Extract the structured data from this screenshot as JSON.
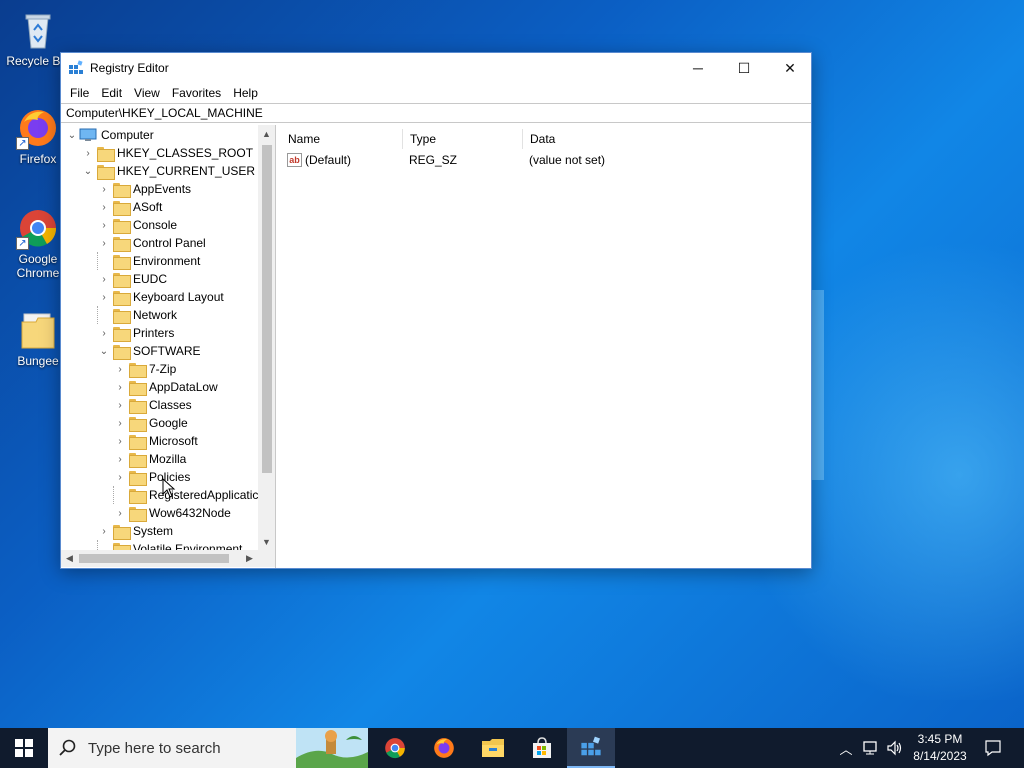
{
  "desktop": {
    "icons": [
      {
        "label": "Recycle Bin",
        "icon": "recycle-bin-icon"
      },
      {
        "label": "Firefox",
        "icon": "firefox-icon"
      },
      {
        "label": "Google Chrome",
        "icon": "chrome-icon"
      },
      {
        "label": "Bungee",
        "icon": "folder-icon"
      }
    ]
  },
  "window": {
    "title": "Registry Editor",
    "icon": "regedit-icon",
    "controls": {
      "minimize": "─",
      "maximize": "☐",
      "close": "✕"
    },
    "menu": [
      "File",
      "Edit",
      "View",
      "Favorites",
      "Help"
    ],
    "address": "Computer\\HKEY_LOCAL_MACHINE"
  },
  "tree": {
    "root": "Computer",
    "items": [
      {
        "label": "HKEY_CLASSES_ROOT",
        "level": 1,
        "chevron": "›"
      },
      {
        "label": "HKEY_CURRENT_USER",
        "level": 1,
        "chevron": "⌄"
      },
      {
        "label": "AppEvents",
        "level": 2,
        "chevron": "›"
      },
      {
        "label": "ASoft",
        "level": 2,
        "chevron": "›"
      },
      {
        "label": "Console",
        "level": 2,
        "chevron": "›"
      },
      {
        "label": "Control Panel",
        "level": 2,
        "chevron": "›"
      },
      {
        "label": "Environment",
        "level": 2,
        "chevron": ""
      },
      {
        "label": "EUDC",
        "level": 2,
        "chevron": "›"
      },
      {
        "label": "Keyboard Layout",
        "level": 2,
        "chevron": "›"
      },
      {
        "label": "Network",
        "level": 2,
        "chevron": ""
      },
      {
        "label": "Printers",
        "level": 2,
        "chevron": "›"
      },
      {
        "label": "SOFTWARE",
        "level": 2,
        "chevron": "⌄"
      },
      {
        "label": "7-Zip",
        "level": 3,
        "chevron": "›"
      },
      {
        "label": "AppDataLow",
        "level": 3,
        "chevron": "›"
      },
      {
        "label": "Classes",
        "level": 3,
        "chevron": "›"
      },
      {
        "label": "Google",
        "level": 3,
        "chevron": "›"
      },
      {
        "label": "Microsoft",
        "level": 3,
        "chevron": "›"
      },
      {
        "label": "Mozilla",
        "level": 3,
        "chevron": "›"
      },
      {
        "label": "Policies",
        "level": 3,
        "chevron": "›"
      },
      {
        "label": "RegisteredApplicatic",
        "level": 3,
        "chevron": ""
      },
      {
        "label": "Wow6432Node",
        "level": 3,
        "chevron": "›"
      },
      {
        "label": "System",
        "level": 2,
        "chevron": "›"
      },
      {
        "label": "Volatile Environment",
        "level": 2,
        "chevron": ""
      }
    ]
  },
  "values": {
    "columns": [
      "Name",
      "Type",
      "Data"
    ],
    "rows": [
      {
        "name": "(Default)",
        "type": "REG_SZ",
        "data": "(value not set)",
        "icon": "string-value-icon",
        "icon_text": "ab"
      }
    ]
  },
  "taskbar": {
    "search_placeholder": "Type here to search",
    "apps": [
      "chrome-icon",
      "firefox-icon",
      "file-explorer-icon",
      "store-icon",
      "regedit-icon"
    ],
    "time": "3:45 PM",
    "date": "8/14/2023"
  }
}
